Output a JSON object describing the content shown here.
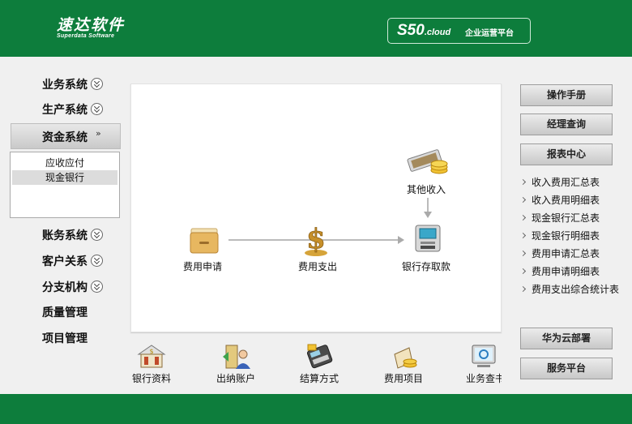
{
  "header": {
    "logo_main": "速达软件",
    "logo_sub": "Superdata Software",
    "product": "S50",
    "product_suffix": ".cloud",
    "product_tagline": "企业运营平台"
  },
  "nav": {
    "items_top": [
      "业务系统",
      "生产系统"
    ],
    "active": "资金系统",
    "submenu": [
      "应收应付",
      "现金银行"
    ],
    "submenu_selected": "现金银行",
    "items_bottom": [
      "账务系统",
      "客户关系",
      "分支机构",
      "质量管理",
      "项目管理"
    ]
  },
  "flow": {
    "request": "费用申请",
    "payment": "费用支出",
    "other_income": "其他收入",
    "bank": "银行存取款"
  },
  "quick": [
    "银行资料",
    "出纳账户",
    "结算方式",
    "费用项目",
    "业务查书"
  ],
  "right": {
    "manual": "操作手册",
    "manager_query": "经理查询",
    "report_center": "报表中心",
    "reports": [
      "收入费用汇总表",
      "收入费用明细表",
      "现金银行汇总表",
      "现金银行明细表",
      "费用申请汇总表",
      "费用申请明细表",
      "费用支出综合统计表"
    ],
    "huawei": "华为云部署",
    "service": "服务平台"
  },
  "colors": {
    "brand_green": "#0d7d3c"
  }
}
